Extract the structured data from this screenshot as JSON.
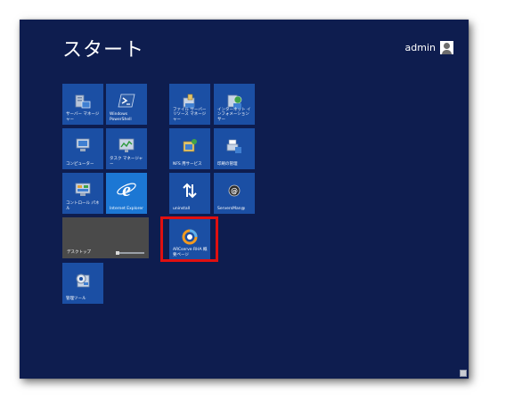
{
  "screen": {
    "title": "スタート",
    "user_name": "admin",
    "background_color": "#0e1d4f"
  },
  "tiles": [
    {
      "label": "サーバー マネージャー",
      "icon": "server-manager-icon"
    },
    {
      "label": "Windows PowerShell",
      "icon": "powershell-icon"
    },
    {
      "label": "コンピューター",
      "icon": "computer-icon"
    },
    {
      "label": "タスク マネージャー",
      "icon": "task-manager-icon"
    },
    {
      "label": "コントロール パネル",
      "icon": "control-panel-icon"
    },
    {
      "label": "Internet Explorer",
      "icon": "internet-explorer-icon"
    },
    {
      "label": "デスクトップ",
      "icon": "desktop-icon"
    },
    {
      "label": "管理ツール",
      "icon": "admin-tools-icon"
    },
    {
      "label": "ファイル サーバー リソース マネージャー",
      "icon": "file-server-icon"
    },
    {
      "label": "インターネット インフォメーション サー",
      "icon": "iis-icon"
    },
    {
      "label": "NFS 用サービス",
      "icon": "nfs-icon"
    },
    {
      "label": "印刷の管理",
      "icon": "print-management-icon"
    },
    {
      "label": "uninstall",
      "icon": "uninstall-icon"
    },
    {
      "label": "ServersMan@",
      "icon": "serversman-icon"
    },
    {
      "label": "ARCserve RHA 概要ページ",
      "icon": "arcserve-icon"
    }
  ],
  "highlight_color": "#e01010"
}
